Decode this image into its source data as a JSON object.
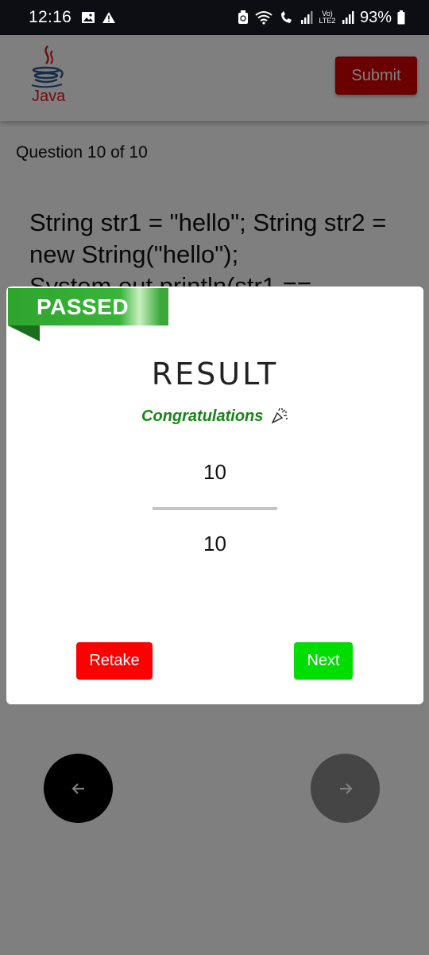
{
  "status_bar": {
    "time": "12:16",
    "battery_percent": "93%",
    "network_label": "Vo) LTE2"
  },
  "header": {
    "logo_text": "Java",
    "submit_label": "Submit"
  },
  "question": {
    "counter": "Question 10 of 10",
    "text": "String str1 = \"hello\"; String str2 = new String(\"hello\"); System.out.println(str1 =="
  },
  "dialog": {
    "badge": "PASSED",
    "title": "RESULT",
    "message": "Congratulations",
    "message_icon": "party-popper-icon",
    "score": "10",
    "total": "10",
    "retake_label": "Retake",
    "next_label": "Next"
  },
  "nav": {
    "prev_icon": "arrow-left-icon",
    "next_icon": "arrow-right-icon"
  },
  "colors": {
    "submit": "#d40000",
    "passed": "#2ea52e",
    "congrats": "#178517",
    "retake": "#ff0000",
    "next": "#00dd00"
  }
}
